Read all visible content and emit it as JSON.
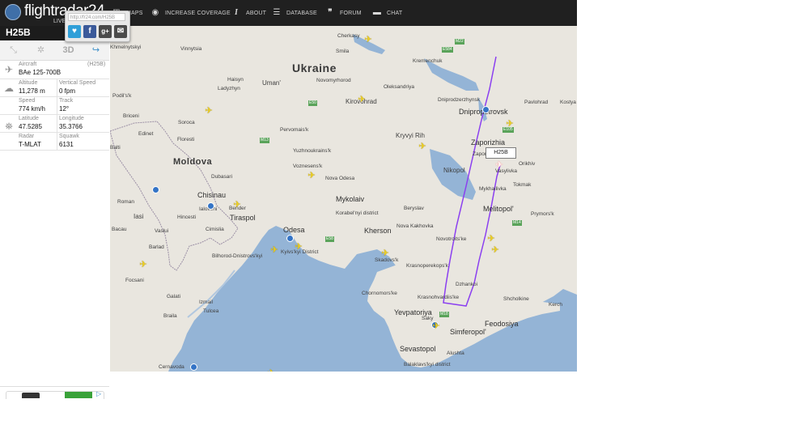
{
  "brand": {
    "wordmark": "flightradar24",
    "live": "LIVE"
  },
  "nav": [
    {
      "icon": "maps-icon",
      "label": "MAPS"
    },
    {
      "icon": "eye-icon",
      "label": "INCREASE COVERAGE"
    },
    {
      "icon": "info-icon",
      "label": "ABOUT"
    },
    {
      "icon": "database-icon",
      "label": "DATABASE"
    },
    {
      "icon": "quote-icon",
      "label": "FORUM"
    },
    {
      "icon": "chat-icon",
      "label": "CHAT"
    }
  ],
  "share": {
    "url": "http://fr24.com/H25B",
    "buttons": [
      {
        "icon": "twitter-icon",
        "color": "#2f9fd8"
      },
      {
        "icon": "facebook-icon",
        "color": "#3b5a9a"
      },
      {
        "icon": "google-plus-icon",
        "color": "#4a4a4a"
      },
      {
        "icon": "email-icon",
        "color": "#4a4a4a"
      }
    ]
  },
  "flight": {
    "callsign": "H25B",
    "aircraft_label": "Aircraft",
    "aircraft_code": "(H25B)",
    "aircraft": "BAe 125-700B",
    "altitude_label": "Altitude",
    "altitude": "11,278 m",
    "vspeed_label": "Vertical Speed",
    "vspeed": "0 fpm",
    "speed_label": "Speed",
    "speed": "774 km/h",
    "track_label": "Track",
    "track": "12°",
    "lat_label": "Latitude",
    "lat": "47.5285",
    "lon_label": "Longitude",
    "lon": "35.3766",
    "radar_label": "Radar",
    "radar": "T-MLAT",
    "squawk_label": "Squawk",
    "squawk": "6131"
  },
  "toolbar": {
    "threed": "3D"
  },
  "map": {
    "tag": "H25B",
    "places": {
      "ukraine": "Ukraine",
      "moldova": "Moldova",
      "khmelnytskyi": "Khmelnytskyi",
      "vinnytsia": "Vinnytsia",
      "cherkasy": "Cherkasy",
      "smila": "Smila",
      "kremenchuk": "Kremenchuk",
      "uman": "Uman'",
      "haisyn": "Haisyn",
      "ladyzhyn": "Ladyzhyn",
      "novomyrhorod": "Novomyrhorod",
      "oleksandriya": "Oleksandriya",
      "kirovohrad": "Kirovohrad",
      "dniprodzerzhynsk": "Dniprodzerzhynsk",
      "dnipropetrovsk": "Dnipropetrovsk",
      "pavlohrad": "Pavlohrad",
      "kostya": "Kostya",
      "podilsk": "Podil's'k",
      "briceni": "Briceni",
      "soroca": "Soroca",
      "edinet": "Edinet",
      "floresti": "Floresti",
      "pervomaisk": "Pervomais'k",
      "kryvyi_rih": "Kryvyi Rih",
      "zaporizhia": "Zaporizhia",
      "zaporizhia_district": "Zaporizhia district",
      "vasylivka": "Vasylivka",
      "orikhiv": "Orikhiv",
      "tokmak": "Tokmak",
      "balti": "Balti",
      "dubasari": "Dubasari",
      "yuzhnoukrainsk": "Yuzhnoukrains'k",
      "voznesensk": "Voznesens'k",
      "nova_odesa": "Nova Odesa",
      "nikopol": "Nikopol",
      "mykhailivka": "Mykhailivka",
      "chisinau": "Chisinau",
      "ialoveni": "Ialoveni",
      "tiraspol": "Tiraspol",
      "bender": "Bender",
      "mykolaiv": "Mykolaiv",
      "berysla": "Beryslav",
      "nova_kakhovka": "Nova Kakhovka",
      "melitopol": "Melitopol'",
      "prymorsk": "Prymors'k",
      "roman": "Roman",
      "iasi": "Iasi",
      "hincesti": "Hincesti",
      "cimislia": "Cimislia",
      "odesa": "Odesa",
      "kyivskyi_district": "Kyivs'kyi District",
      "koralevskyi": "Korabel'nyi district",
      "kherson": "Kherson",
      "novotroitske": "Novotroits'ke",
      "bacau": "Bacau",
      "barlad": "Barlad",
      "bilhorod": "Bilhorod-Dnistrovs'kyi",
      "skadovsk": "Skadovs'k",
      "krasnoperekopsk": "Krasnoperekops'k",
      "dzhankoi": "Dzhankoi",
      "focsani": "Focsani",
      "vaslui": "Vaslui",
      "galati": "Galati",
      "tulcea": "Tulcea",
      "izmail": "Izmail",
      "chornomorske": "Chornomors'ke",
      "krasnohvardiiske": "Krasnohvardiis'ke",
      "shcholkine": "Shcholkine",
      "kerch": "Kerch",
      "yevpatoriya": "Yevpatoriya",
      "simferopol": "Simferopol'",
      "feodosiya": "Feodosiya",
      "saky": "Saky",
      "braila": "Braila",
      "sevastopol": "Sevastopol",
      "alushta": "Alushta",
      "balaklava": "Balaklavs'kyi district",
      "cernavoda": "Cernavoda"
    }
  }
}
